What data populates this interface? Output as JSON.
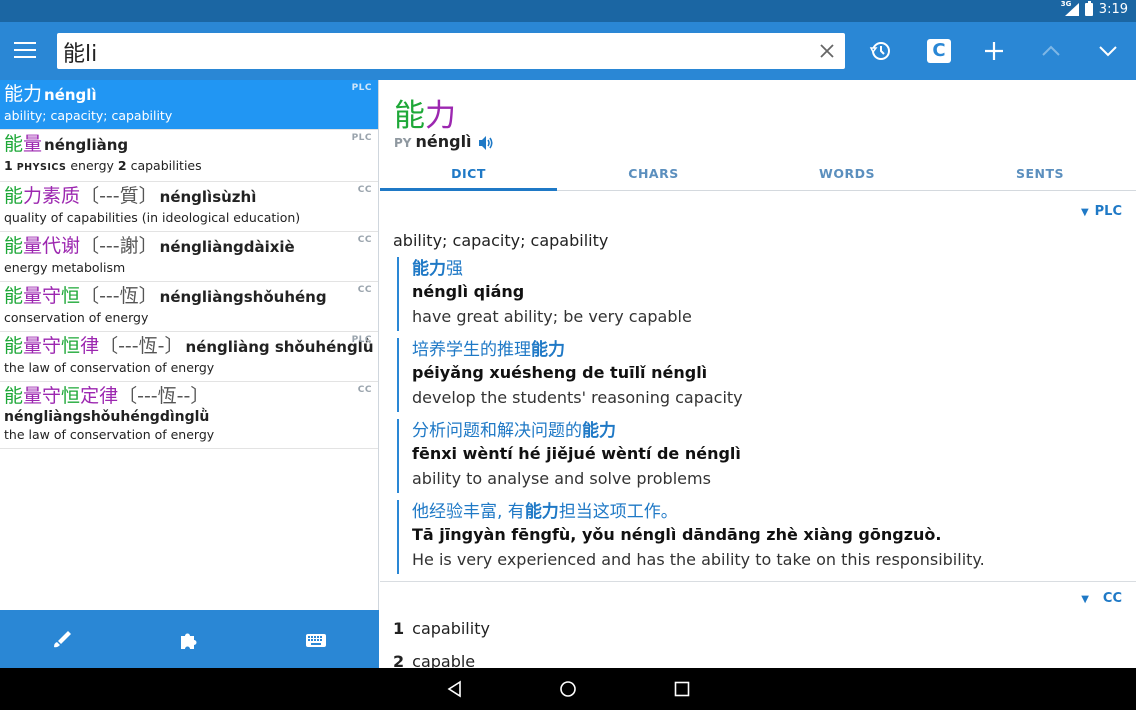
{
  "status": {
    "network": "3G",
    "time": "3:19"
  },
  "search": {
    "query": "能li"
  },
  "entries": [
    {
      "chars": [
        "能",
        "力"
      ],
      "pinyin": "nénglì",
      "def": "ability; capacity; capability",
      "src": "PLC"
    },
    {
      "chars": [
        "能",
        "量"
      ],
      "pinyin": "néngliàng",
      "def_num1": "1",
      "def_tag": "PHYSICS",
      "def_a": "energy",
      "def_num2": "2",
      "def_b": "capabilities",
      "src": "PLC"
    },
    {
      "chars": [
        "能",
        "力",
        "素",
        "质"
      ],
      "trad": "〔---質〕",
      "pinyin": "nénglìsùzhì",
      "def": "quality of capabilities (in ideological education)",
      "src": "CC"
    },
    {
      "chars": [
        "能",
        "量",
        "代",
        "谢"
      ],
      "trad": "〔---謝〕",
      "pinyin": "néngliàngdàixiè",
      "def": "energy metabolism",
      "src": "CC"
    },
    {
      "chars": [
        "能",
        "量",
        "守",
        "恒"
      ],
      "trad": "〔---恆〕",
      "pinyin": "néngliàngshǒuhéng",
      "def": "conservation of energy",
      "src": "CC"
    },
    {
      "chars": [
        "能",
        "量",
        "守",
        "恒",
        "律"
      ],
      "trad": "〔---恆-〕",
      "pinyin": "néngliàng shǒuhénglǜ",
      "def": "the law of conservation of energy",
      "src": "PLC"
    },
    {
      "chars": [
        "能",
        "量",
        "守",
        "恒",
        "定",
        "律"
      ],
      "trad": "〔---恆--〕",
      "pinyin": "néngliàngshǒuhéngdìnglǜ",
      "def": "the law of conservation of energy",
      "src": "CC"
    }
  ],
  "detail": {
    "headword": [
      "能",
      "力"
    ],
    "py_label": "PY",
    "pinyin": "nénglì",
    "tabs": [
      "DICT",
      "CHARS",
      "WORDS",
      "SENTS"
    ],
    "source1": "PLC",
    "sense": "ability; capacity; capability",
    "examples": [
      {
        "zh_pre": "",
        "zh_key": "能力",
        "zh_post": "强",
        "py_pre": "nénglì",
        "py_key": "",
        "py_post": " qiáng",
        "en": "have great ability; be very capable"
      },
      {
        "zh_pre": "培养学生的推理",
        "zh_key": "能力",
        "zh_post": "",
        "py_pre": "péiyǎng xuésheng de tuīlǐ ",
        "py_key": "nénglì",
        "py_post": "",
        "en": "develop the students' reasoning capacity"
      },
      {
        "zh_pre": "分析问题和解决问题的",
        "zh_key": "能力",
        "zh_post": "",
        "py_pre": "fēnxi wèntí hé jiějué wèntí de ",
        "py_key": "nénglì",
        "py_post": "",
        "en": "ability to analyse and solve problems"
      },
      {
        "zh_pre": "他经验丰富, 有",
        "zh_key": "能力",
        "zh_post": "担当这项工作。",
        "py_pre": "Tā jīngyàn fēngfù, yǒu ",
        "py_key": "nénglì",
        "py_post": " dāndāng zhè xiàng gōngzuò.",
        "en": "He is very experienced and has the ability to take on this responsibility."
      }
    ],
    "source2": "CC",
    "cc_defs": [
      {
        "num": "1",
        "text": "capability"
      },
      {
        "num": "2",
        "text": "capable"
      }
    ]
  },
  "colors": {
    "toolbar": "#2a87d5",
    "statusbar": "#1b66a3",
    "selected": "#2196f3",
    "tone2": "#1ea838",
    "tone4": "#9c27b0"
  }
}
